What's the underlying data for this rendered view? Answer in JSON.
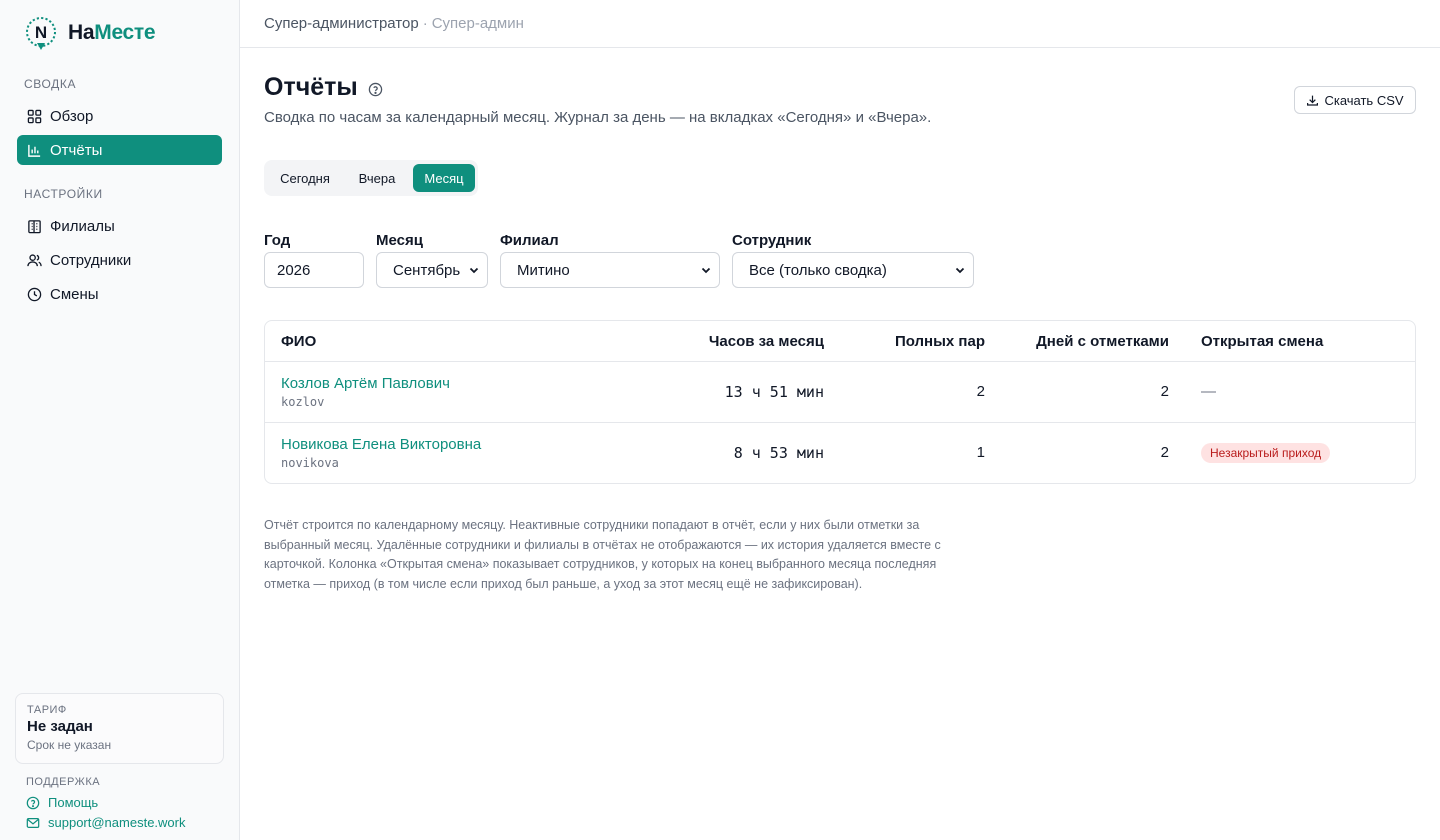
{
  "brand": {
    "part1": "На",
    "part2": "Месте",
    "mark_letter": "N"
  },
  "sidebar": {
    "section_summary": "СВОДКА",
    "section_settings": "НАСТРОЙКИ",
    "items": [
      {
        "label": "Обзор",
        "icon": "grid-icon"
      },
      {
        "label": "Отчёты",
        "icon": "bar-chart-icon",
        "active": true
      },
      {
        "label": "Филиалы",
        "icon": "building-icon"
      },
      {
        "label": "Сотрудники",
        "icon": "users-icon"
      },
      {
        "label": "Смены",
        "icon": "clock-icon"
      }
    ],
    "tariff": {
      "label": "ТАРИФ",
      "value": "Не задан",
      "sub": "Срок не указан"
    },
    "support": {
      "title": "ПОДДЕРЖКА",
      "help": "Помощь",
      "email": "support@nameste.work"
    }
  },
  "header": {
    "role": "Супер-администратор",
    "separator": "·",
    "role_short": "Супер-админ"
  },
  "page": {
    "title": "Отчёты",
    "subtitle": "Сводка по часам за календарный месяц. Журнал за день — на вкладках «Сегодня» и «Вчера».",
    "csv_button": "Скачать CSV",
    "tabs": [
      {
        "label": "Сегодня"
      },
      {
        "label": "Вчера"
      },
      {
        "label": "Месяц",
        "active": true
      }
    ]
  },
  "filters": {
    "year": {
      "label": "Год",
      "value": "2026"
    },
    "month": {
      "label": "Месяц",
      "value": "Сентябрь"
    },
    "branch": {
      "label": "Филиал",
      "value": "Митино"
    },
    "employee": {
      "label": "Сотрудник",
      "value": "Все (только сводка)"
    }
  },
  "table": {
    "columns": [
      "ФИО",
      "Часов за месяц",
      "Полных пар",
      "Дней с отметками",
      "Открытая смена"
    ],
    "rows": [
      {
        "name": "Козлов Артём Павлович",
        "login": "kozlov",
        "hours": "13 ч 51 мин",
        "pairs": "2",
        "days": "2",
        "open_shift": "—"
      },
      {
        "name": "Новикова Елена Викторовна",
        "login": "novikova",
        "hours": "8 ч 53 мин",
        "pairs": "1",
        "days": "2",
        "open_shift": "Незакрытый приход"
      }
    ]
  },
  "note": "Отчёт строится по календарному месяцу. Неактивные сотрудники попадают в отчёт, если у них были отметки за выбранный месяц. Удалённые сотрудники и филиалы в отчётах не отображаются — их история удаляется вместе с карточкой. Колонка «Открытая смена» показывает сотрудников, у которых на конец выбранного месяца последняя отметка — приход (в том числе если приход был раньше, а уход за этот месяц ещё не зафиксирован).",
  "colors": {
    "accent": "#0f8f7e",
    "badge_bg": "#fee2e2",
    "badge_text": "#b91c1c"
  }
}
